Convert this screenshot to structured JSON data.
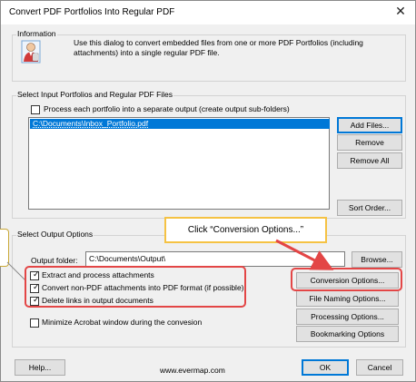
{
  "window": {
    "title": "Convert PDF Portfolios Into Regular PDF",
    "close_glyph": "✕"
  },
  "information": {
    "group_label": "Information",
    "text": "Use this dialog to convert embedded files from one or more PDF Portfolios (including attachments) into a single regular PDF file.",
    "icon": "user-info-icon"
  },
  "input": {
    "group_label": "Select Input Portfolios and Regular PDF Files",
    "separate_output_label": "Process each portfolio into a separate output (create output sub-folders)",
    "separate_output_checked": false,
    "files": [
      "C:\\Documents\\Inbox_Portfolio.pdf"
    ],
    "buttons": {
      "add_files": "Add Files...",
      "remove": "Remove",
      "remove_all": "Remove All",
      "sort_order": "Sort Order..."
    }
  },
  "output": {
    "group_label": "Select Output Options",
    "folder_label": "Output folder:",
    "folder_value": "C:\\Documents\\Output\\",
    "browse": "Browse...",
    "options": [
      {
        "label": "Extract and process attachments",
        "checked": true
      },
      {
        "label": "Convert non-PDF attachments into PDF format (if possible)",
        "checked": true
      },
      {
        "label": "Delete links in output documents",
        "checked": true
      }
    ],
    "minimize_label": "Minimize Acrobat window during the convesion",
    "minimize_checked": false,
    "buttons": {
      "conversion_options": "Conversion Options...",
      "file_naming_options": "File Naming Options...",
      "processing_options": "Processing Options...",
      "bookmarking_options": "Bookmarking Options"
    }
  },
  "callout": {
    "text": "Click “Conversion Options...”"
  },
  "footer": {
    "help": "Help...",
    "website": "www.evermap.com",
    "ok": "OK",
    "cancel": "Cancel"
  },
  "colors": {
    "selection": "#0078d7",
    "highlight": "#e34646",
    "callout_border": "#f5c243",
    "arrow": "#e34646"
  }
}
